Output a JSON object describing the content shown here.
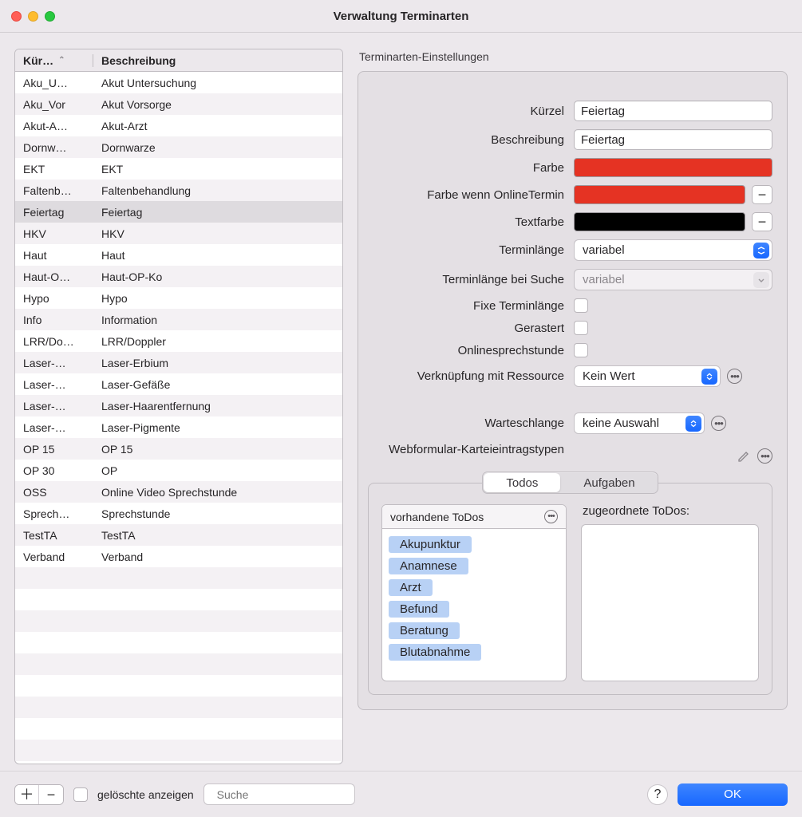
{
  "window": {
    "title": "Verwaltung Terminarten"
  },
  "table": {
    "headers": {
      "kuerzel": "Kür…",
      "beschreibung": "Beschreibung"
    },
    "selected_index": 6,
    "rows": [
      {
        "k": "Aku_U…",
        "b": "Akut Untersuchung"
      },
      {
        "k": "Aku_Vor",
        "b": "Akut Vorsorge"
      },
      {
        "k": "Akut-A…",
        "b": "Akut-Arzt"
      },
      {
        "k": "Dornw…",
        "b": "Dornwarze"
      },
      {
        "k": "EKT",
        "b": "EKT"
      },
      {
        "k": "Faltenb…",
        "b": "Faltenbehandlung"
      },
      {
        "k": "Feiertag",
        "b": "Feiertag"
      },
      {
        "k": "HKV",
        "b": "HKV"
      },
      {
        "k": "Haut",
        "b": "Haut"
      },
      {
        "k": "Haut-O…",
        "b": "Haut-OP-Ko"
      },
      {
        "k": "Hypo",
        "b": "Hypo"
      },
      {
        "k": "Info",
        "b": "Information"
      },
      {
        "k": "LRR/Do…",
        "b": "LRR/Doppler"
      },
      {
        "k": "Laser-…",
        "b": "Laser-Erbium"
      },
      {
        "k": "Laser-…",
        "b": "Laser-Gefäße"
      },
      {
        "k": "Laser-…",
        "b": "Laser-Haarentfernung"
      },
      {
        "k": "Laser-…",
        "b": "Laser-Pigmente"
      },
      {
        "k": "OP 15",
        "b": "OP 15"
      },
      {
        "k": "OP 30",
        "b": "OP"
      },
      {
        "k": "OSS",
        "b": "Online Video Sprechstunde"
      },
      {
        "k": "Sprech…",
        "b": "Sprechstunde"
      },
      {
        "k": "TestTA",
        "b": "TestTA"
      },
      {
        "k": "Verband",
        "b": "Verband"
      }
    ],
    "blank_rows": 9
  },
  "settings": {
    "section_title": "Terminarten-Einstellungen",
    "labels": {
      "kuerzel": "Kürzel",
      "beschreibung": "Beschreibung",
      "farbe": "Farbe",
      "farbe_online": "Farbe wenn OnlineTermin",
      "textfarbe": "Textfarbe",
      "terminlaenge": "Terminlänge",
      "terminlaenge_suche": "Terminlänge bei Suche",
      "fixe_terminlaenge": "Fixe Terminlänge",
      "gerastert": "Gerastert",
      "onlinesprechstunde": "Onlinesprechstunde",
      "ressource": "Verknüpfung mit Ressource",
      "warteschlange": "Warteschlange",
      "webformular": "Webformular-Karteieintragstypen"
    },
    "values": {
      "kuerzel": "Feiertag",
      "beschreibung": "Feiertag",
      "farbe": "#e53323",
      "farbe_online": "#e53323",
      "textfarbe": "#000000",
      "terminlaenge": "variabel",
      "terminlaenge_suche": "variabel",
      "ressource": "Kein Wert",
      "warteschlange": "keine Auswahl"
    }
  },
  "tabs": {
    "todos": "Todos",
    "aufgaben": "Aufgaben",
    "vorhandene_header": "vorhandene ToDos",
    "zugeordnete_label": "zugeordnete ToDos:",
    "items": [
      "Akupunktur",
      "Anamnese",
      "Arzt",
      "Befund",
      "Beratung",
      "Blutabnahme"
    ]
  },
  "footer": {
    "deleted_label": "gelöschte anzeigen",
    "search_placeholder": "Suche",
    "ok": "OK"
  }
}
